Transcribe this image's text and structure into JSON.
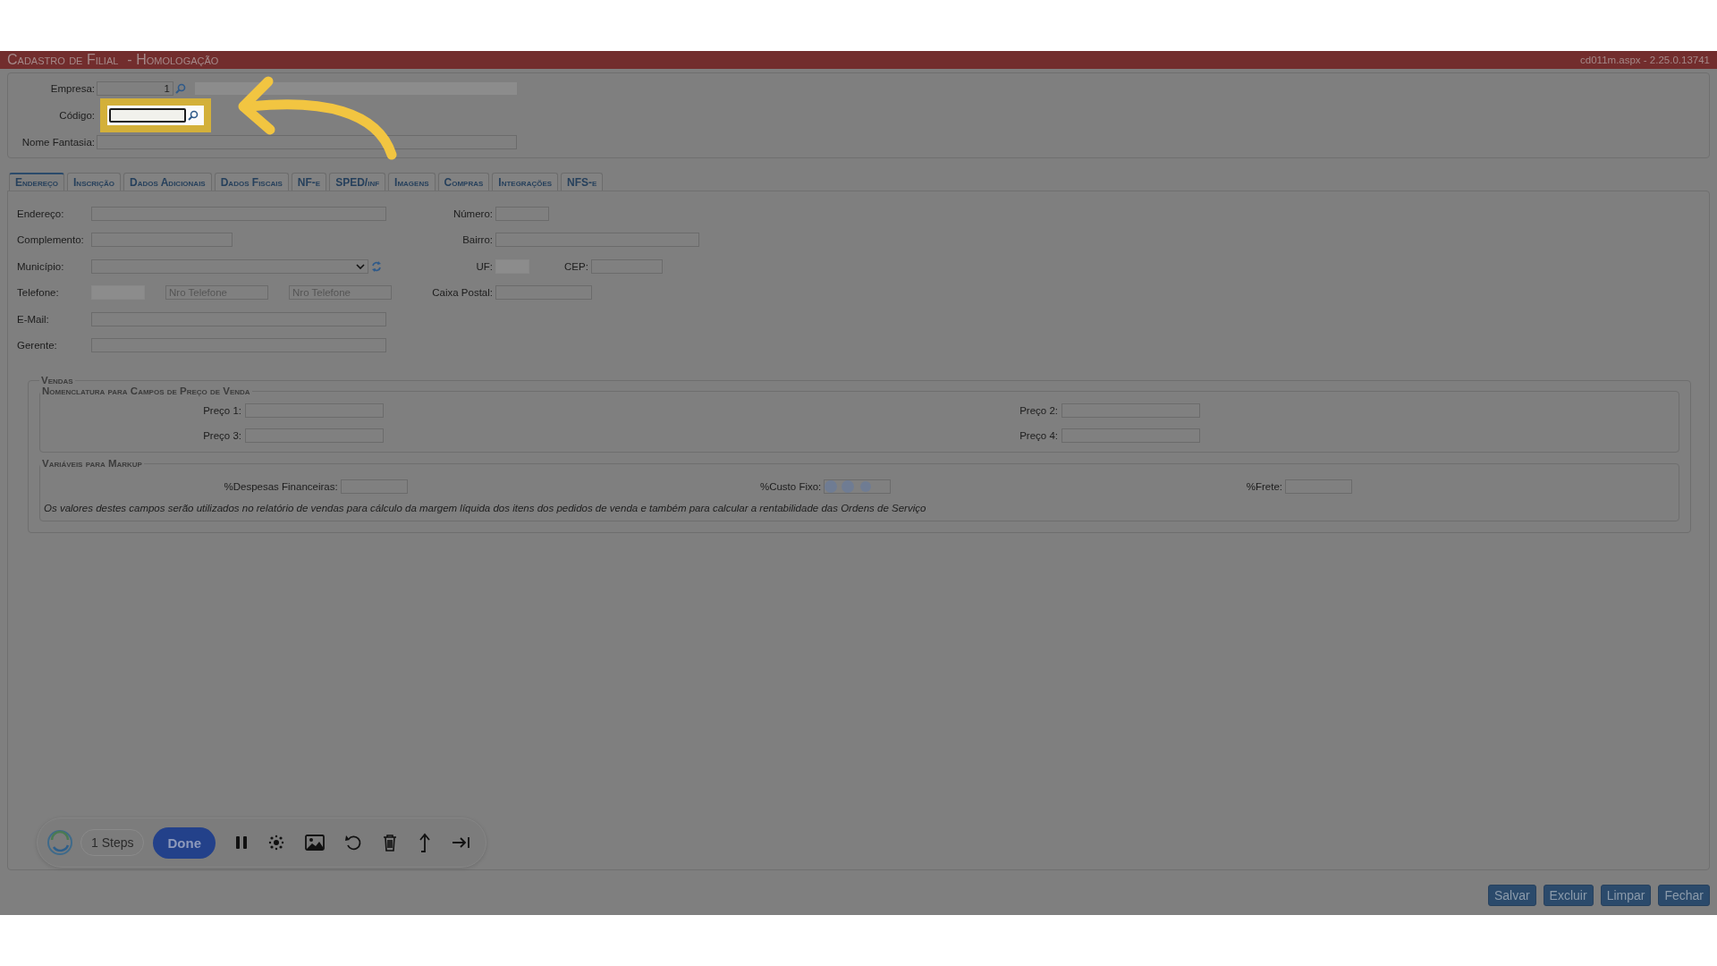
{
  "header": {
    "title": "Cadastro de Filial",
    "subtitle": "- Homologação",
    "version": "cd011m.aspx - 2.25.0.13741"
  },
  "top_fields": [
    {
      "label": "Empresa:",
      "value": "1",
      "kind": "lookup",
      "highlighted": false
    },
    {
      "label": "Código:",
      "kind": "lookup-empty",
      "highlighted": true
    },
    {
      "label": "Nome Fantasia:",
      "kind": "wide",
      "highlighted": false
    }
  ],
  "tabs": [
    {
      "label": "Endereço",
      "selected": true
    },
    {
      "label": "Inscrição",
      "selected": false
    },
    {
      "label": "Dados Adicionais",
      "selected": false
    },
    {
      "label": "Dados Fiscais",
      "selected": false
    },
    {
      "label": "NF-e",
      "selected": false
    },
    {
      "label": "SPED/inf",
      "selected": false
    },
    {
      "label": "Imagens",
      "selected": false
    },
    {
      "label": "Compras",
      "selected": false
    },
    {
      "label": "Integrações",
      "selected": false
    },
    {
      "label": "NFS-e",
      "selected": false
    }
  ],
  "address_left": [
    {
      "label": "Endereço:",
      "kind": "long"
    },
    {
      "label": "Complemento:",
      "kind": "medium"
    },
    {
      "label": "Município:",
      "kind": "select"
    },
    {
      "label": "Telefone:",
      "kind": "phone",
      "placeholders": [
        "Nro Telefone",
        "Nro Telefone"
      ]
    },
    {
      "label": "E-Mail:",
      "kind": "long"
    },
    {
      "label": "Gerente:",
      "kind": "long"
    }
  ],
  "address_right": [
    {
      "label": "Número:",
      "kind": "short"
    },
    {
      "label": "Bairro:",
      "kind": "medium"
    },
    {
      "label": "UF:",
      "kind": "uf",
      "second_label": "CEP:"
    },
    {
      "label": "Caixa Postal:",
      "kind": "postal"
    }
  ],
  "vendas": {
    "legend": "Vendas",
    "prices": {
      "legend": "Nomenclatura para Campos de Preço de Venda",
      "fields": [
        "Preço 1:",
        "Preço 2:",
        "Preço 3:",
        "Preço 4:"
      ]
    },
    "markup": {
      "legend": "Variáveis para Markup",
      "fields": [
        {
          "label": "%Despesas Financeiras:",
          "loading": false
        },
        {
          "label": "%Custo Fixo:",
          "loading": true
        },
        {
          "label": "%Frete:",
          "loading": false
        }
      ],
      "note": "Os valores destes campos serão utilizados no relatório de vendas para cálculo da margem líquida dos itens dos pedidos de venda e também para calcular a rentabilidade das Ordens de Serviço"
    }
  },
  "recorder": {
    "steps": "1 Steps",
    "done": "Done"
  },
  "buttons": [
    "Salvar",
    "Excluir",
    "Limpar",
    "Fechar"
  ]
}
